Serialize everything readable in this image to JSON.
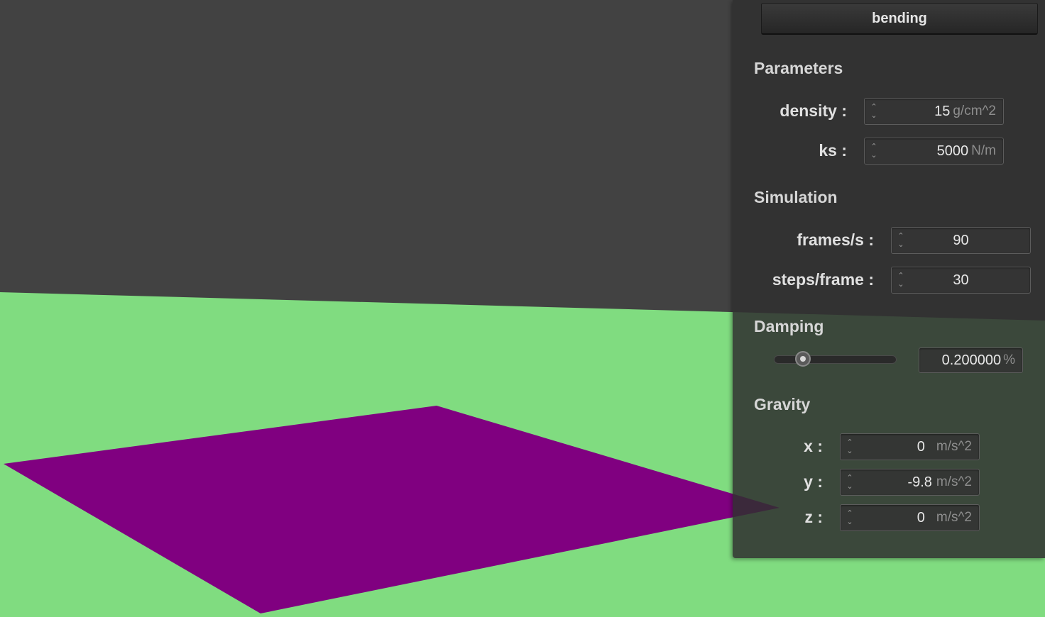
{
  "toolbar": {
    "mode_label": "bending"
  },
  "scene": {
    "sky_color": "#424242",
    "ground_color": "#80dc80",
    "cloth_color": "#800080"
  },
  "parameters": {
    "title": "Parameters",
    "density": {
      "label": "density :",
      "value": "15",
      "unit": "g/cm^2"
    },
    "ks": {
      "label": "ks :",
      "value": "5000",
      "unit": "N/m"
    }
  },
  "simulation": {
    "title": "Simulation",
    "fps": {
      "label": "frames/s :",
      "value": "90"
    },
    "steps": {
      "label": "steps/frame :",
      "value": "30"
    }
  },
  "damping": {
    "title": "Damping",
    "value": "0.200000",
    "unit": "%",
    "slider_fraction": 0.2
  },
  "gravity": {
    "title": "Gravity",
    "x": {
      "label": "x :",
      "value": "0",
      "unit": "m/s^2"
    },
    "y": {
      "label": "y :",
      "value": "-9.8",
      "unit": "m/s^2"
    },
    "z": {
      "label": "z :",
      "value": "0",
      "unit": "m/s^2"
    }
  }
}
